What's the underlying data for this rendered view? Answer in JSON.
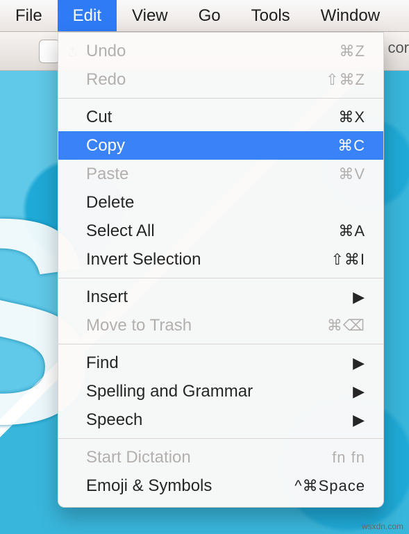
{
  "menubar": {
    "file": "File",
    "edit": "Edit",
    "view": "View",
    "go": "Go",
    "tools": "Tools",
    "window": "Window"
  },
  "toolbar": {
    "cut_label": "cor"
  },
  "menu": {
    "undo": {
      "label": "Undo",
      "shortcut": "⌘Z"
    },
    "redo": {
      "label": "Redo",
      "shortcut": "⇧⌘Z"
    },
    "cut": {
      "label": "Cut",
      "shortcut": "⌘X"
    },
    "copy": {
      "label": "Copy",
      "shortcut": "⌘C"
    },
    "paste": {
      "label": "Paste",
      "shortcut": "⌘V"
    },
    "delete": {
      "label": "Delete",
      "shortcut": ""
    },
    "select_all": {
      "label": "Select All",
      "shortcut": "⌘A"
    },
    "invert": {
      "label": "Invert Selection",
      "shortcut": "⇧⌘I"
    },
    "insert": {
      "label": "Insert",
      "shortcut": "▶"
    },
    "trash": {
      "label": "Move to Trash",
      "shortcut": "⌘⌫"
    },
    "find": {
      "label": "Find",
      "shortcut": "▶"
    },
    "spelling": {
      "label": "Spelling and Grammar",
      "shortcut": "▶"
    },
    "speech": {
      "label": "Speech",
      "shortcut": "▶"
    },
    "dictation": {
      "label": "Start Dictation",
      "shortcut": "fn fn"
    },
    "emoji": {
      "label": "Emoji & Symbols",
      "shortcut": "^⌘Space"
    }
  },
  "watermark": "wsxdn.com"
}
